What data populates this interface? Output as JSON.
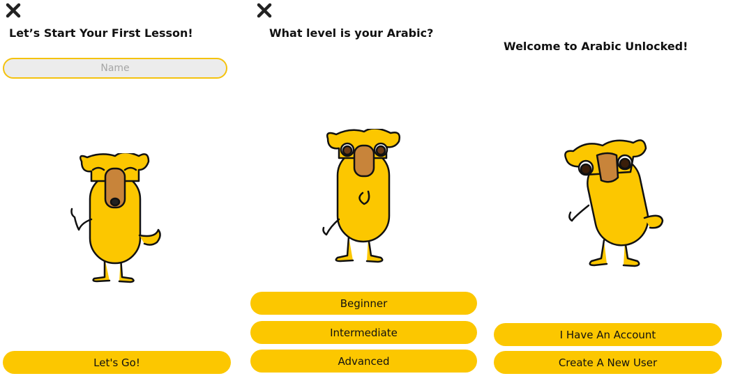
{
  "colors": {
    "accent": "#fcc700",
    "input_border": "#f4c20d",
    "input_bg": "#ececec",
    "camel_body": "#fcc700",
    "camel_snout": "#c8843a",
    "outline": "#111111"
  },
  "screen1": {
    "close_icon": "close-icon",
    "title": "Let’s Start Your First Lesson!",
    "name_placeholder": "Name",
    "go_label": "Let's Go!"
  },
  "screen2": {
    "close_icon": "close-icon",
    "title": "What level is your Arabic?",
    "levels": [
      "Beginner",
      "Intermediate",
      "Advanced"
    ]
  },
  "screen3": {
    "title": "Welcome to Arabic Unlocked!",
    "account_label": "I Have An Account",
    "new_user_label": "Create A New User"
  }
}
